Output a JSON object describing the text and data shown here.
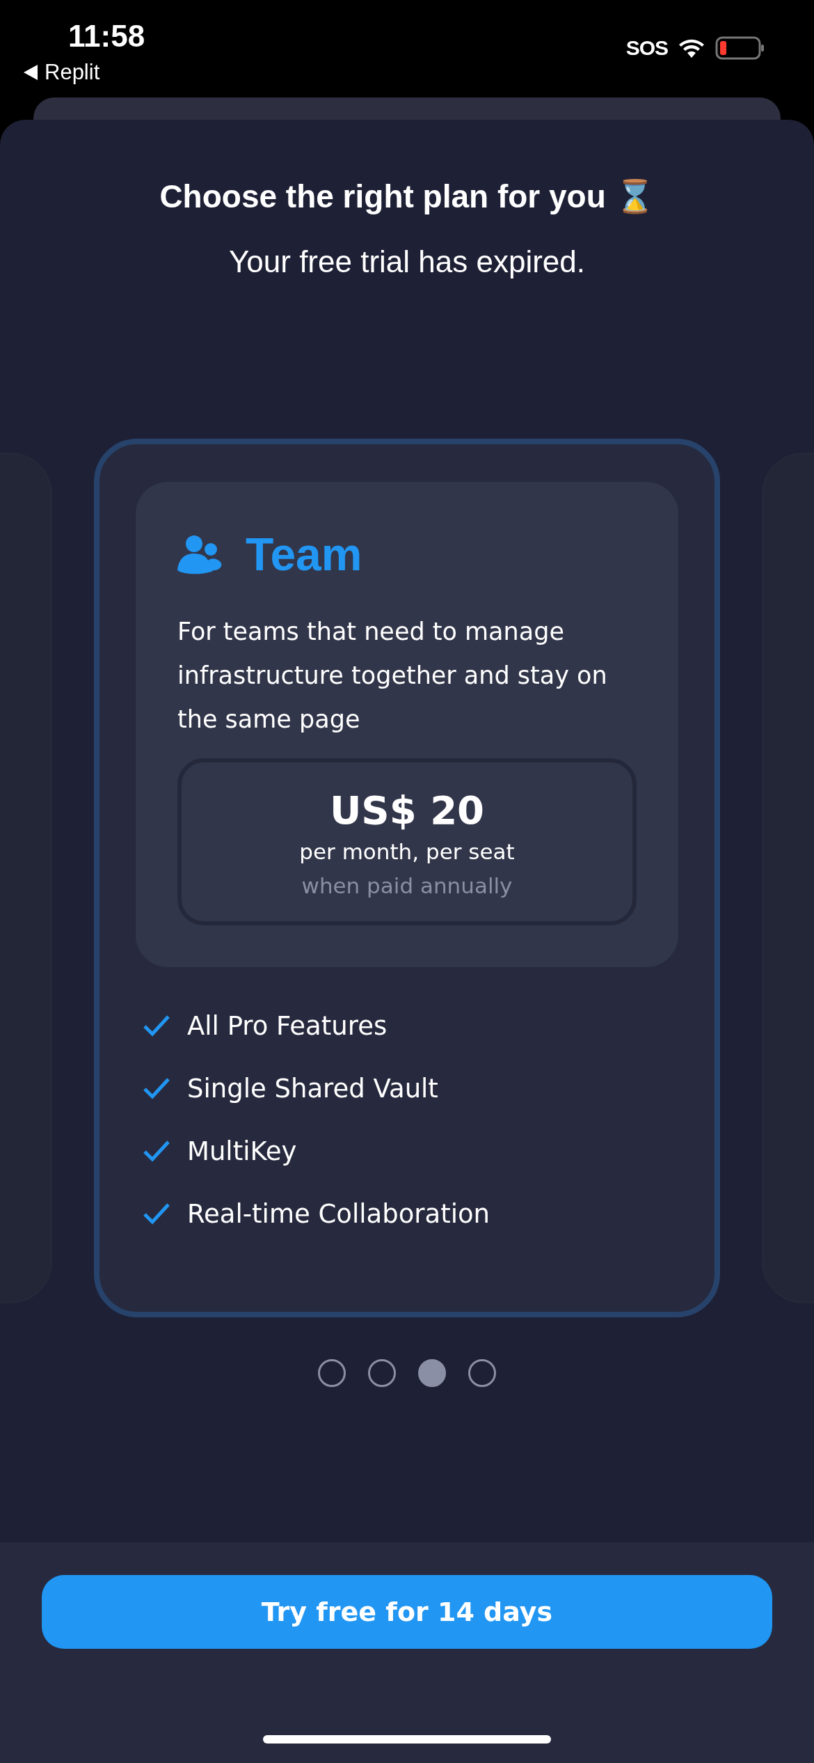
{
  "status_bar": {
    "time": "11:58",
    "back_label": "Replit",
    "sos": "SOS",
    "battery_low": true
  },
  "title": "Choose the right plan for you ⌛",
  "subtitle": "Your free trial has expired.",
  "plan": {
    "name": "Team",
    "description": "For teams that need to manage infrastructure together and stay on the same page",
    "price": "US$ 20",
    "price_unit": "per month, per seat",
    "billing_note": "when paid annually",
    "features": [
      "All Pro Features",
      "Single Shared Vault",
      "MultiKey",
      "Real-time Collaboration"
    ]
  },
  "page_dots": [
    {
      "selected": false
    },
    {
      "selected": false
    },
    {
      "selected": true
    },
    {
      "selected": false
    }
  ],
  "button": "Try free for 14 days"
}
